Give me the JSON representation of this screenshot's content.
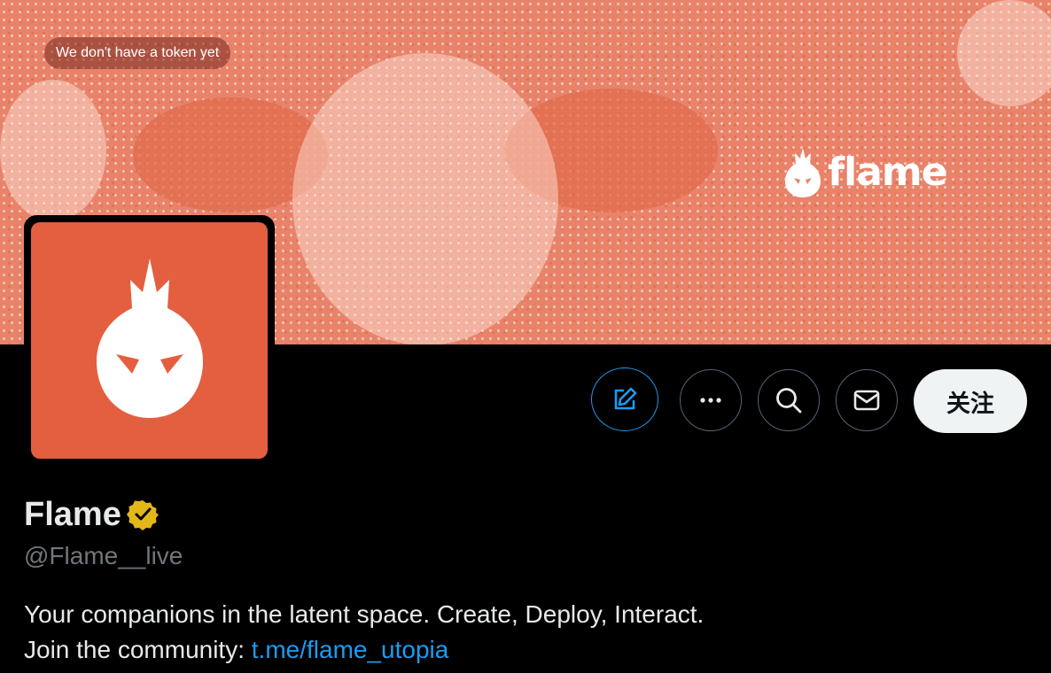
{
  "banner": {
    "token_notice": "We don't have a token yet",
    "logo_text": "flame"
  },
  "actions": {
    "edit_icon": "edit-icon",
    "more_icon": "more-dots-icon",
    "search_icon": "search-icon",
    "message_icon": "mail-icon",
    "follow_label": "关注"
  },
  "profile": {
    "display_name": "Flame",
    "handle": "@Flame__live",
    "bio_line1": "Your companions in the latent space. Create, Deploy, Interact.",
    "bio_line2_prefix": "Join the community: ",
    "bio_link": "t.me/flame_utopia"
  },
  "colors": {
    "banner": "#e8836a",
    "avatar": "#e45f3f",
    "link": "#1d9bf0",
    "verified_badge": "#e2b719",
    "follow_bg": "#eff3f4"
  }
}
